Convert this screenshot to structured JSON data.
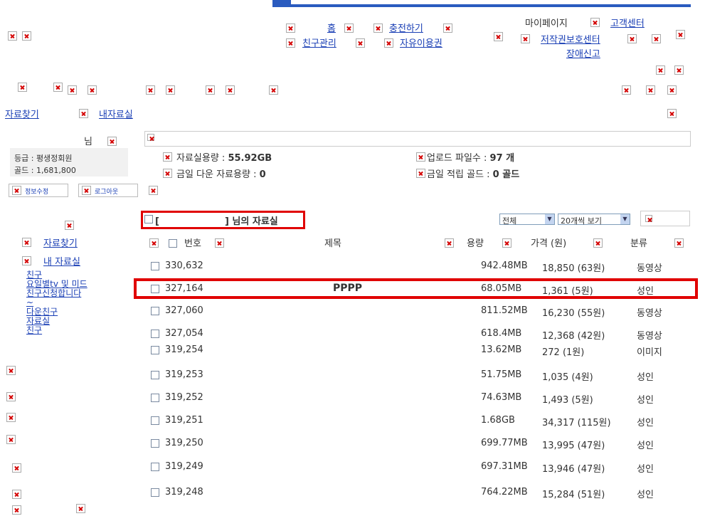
{
  "header": {
    "top_nav": {
      "home": "홈",
      "charge": "충전하기",
      "friends": "친구관리",
      "free_pass": "자유이용권"
    },
    "right_nav": {
      "mypage": "마이페이지",
      "support": "고객센터",
      "copyright": "저작권보호센터",
      "report": "장애신고"
    }
  },
  "subnav": {
    "search": "자료찾기",
    "my": "내자료실"
  },
  "profile": {
    "nim": "님",
    "grade": "등급 : 평생정회원",
    "gold": "골드 : 1,681,800",
    "edit_btn": "정보수정",
    "logout_btn": "로그아웃"
  },
  "stats": {
    "storage": "자료실용량 : ",
    "storage_val": "55.92GB",
    "today_down": "금일 다운 자료용량 : ",
    "today_down_val": "0",
    "upload_cnt": "업로드 파일수 : ",
    "upload_cnt_val": "97 개",
    "today_gold": "금일 적립 골드 : ",
    "today_gold_val": "0 골드"
  },
  "sidebar": {
    "search": "자료찾기",
    "my": "내 자료실",
    "links": [
      "친구",
      "요일별tv 및 미드",
      "친구신청합니다",
      "~",
      "다운친구",
      "자료실",
      "친구"
    ]
  },
  "list": {
    "title_open": "[",
    "title_close": "] 님의 자료실",
    "filter_all": "전체",
    "per_page": "20개씩 보기",
    "columns": {
      "no": "번호",
      "title": "제목",
      "size": "용량",
      "price": "가격 (원)",
      "cat": "분류"
    },
    "rows": [
      {
        "no": "330,632",
        "title": "",
        "size": "942.48MB",
        "price": "18,850 (63원)",
        "cat": "동영상"
      },
      {
        "no": "327,164",
        "title": "PPPP",
        "size": "68.05MB",
        "price": "1,361 (5원)",
        "cat": "성인"
      },
      {
        "no": "327,060",
        "title": "",
        "size": "811.52MB",
        "price": "16,230 (55원)",
        "cat": "동영상"
      },
      {
        "no": "327,054",
        "title": "",
        "size": "618.4MB",
        "price": "12,368 (42원)",
        "cat": "동영상"
      },
      {
        "no": "319,254",
        "title": "",
        "size": "13.62MB",
        "price": "272 (1원)",
        "cat": "이미지"
      },
      {
        "no": "319,253",
        "title": "",
        "size": "51.75MB",
        "price": "1,035 (4원)",
        "cat": "성인"
      },
      {
        "no": "319,252",
        "title": "",
        "size": "74.63MB",
        "price": "1,493 (5원)",
        "cat": "성인"
      },
      {
        "no": "319,251",
        "title": "",
        "size": "1.68GB",
        "price": "34,317 (115원)",
        "cat": "성인"
      },
      {
        "no": "319,250",
        "title": "",
        "size": "699.77MB",
        "price": "13,995 (47원)",
        "cat": "성인"
      },
      {
        "no": "319,249",
        "title": "",
        "size": "697.31MB",
        "price": "13,946 (47원)",
        "cat": "성인"
      },
      {
        "no": "319,248",
        "title": "",
        "size": "764.22MB",
        "price": "15,284 (51원)",
        "cat": "성인"
      }
    ]
  },
  "colors": {
    "link": "#1a3fb5",
    "highlight": "#e00000",
    "topbar": "#2a5bbf"
  }
}
